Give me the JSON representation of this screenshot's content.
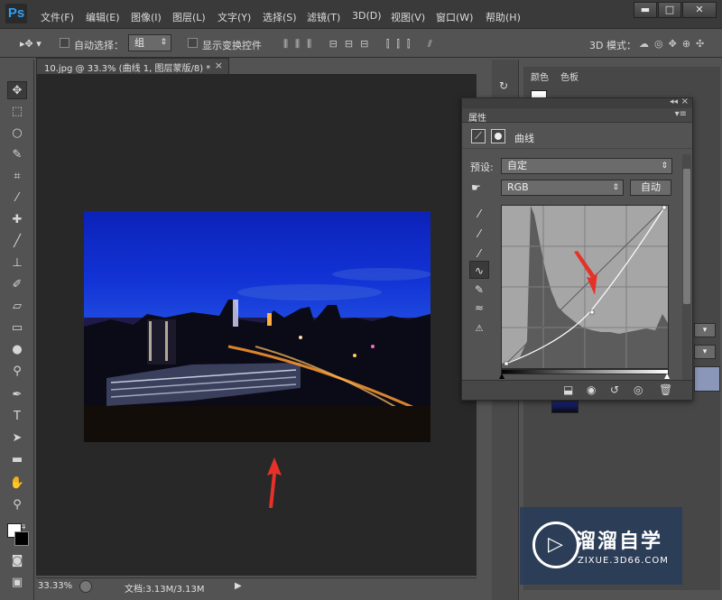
{
  "app": {
    "logo": "Ps"
  },
  "menu": [
    "文件(F)",
    "编辑(E)",
    "图像(I)",
    "图层(L)",
    "文字(Y)",
    "选择(S)",
    "滤镜(T)",
    "3D(D)",
    "视图(V)",
    "窗口(W)",
    "帮助(H)"
  ],
  "window_buttons": {
    "minimize": "▬",
    "restore": "□",
    "close": "✕"
  },
  "options": {
    "auto_select_label": "自动选择：",
    "auto_select_value": "组",
    "show_transform_label": "显示变换控件",
    "mode_3d_label": "3D 模式："
  },
  "document": {
    "tab_title": "10.jpg @ 33.3% (曲线 1, 图层蒙版/8) *",
    "tab_close": "×"
  },
  "status": {
    "zoom": "33.33%",
    "doc_size": "文档:3.13M/3.13M"
  },
  "right_panel": {
    "tab_color": "颜色",
    "tab_swatches": "色板"
  },
  "properties": {
    "title": "属性",
    "adjustment_label": "曲线",
    "preset_label": "预设:",
    "preset_value": "自定",
    "channel_value": "RGB",
    "auto_button": "自动"
  },
  "watermark": {
    "title": "溜溜自学",
    "url": "ZIXUE.3D66.COM"
  },
  "colors": {
    "accent": "#2f9ff3",
    "annotation_arrow": "#e53228"
  }
}
